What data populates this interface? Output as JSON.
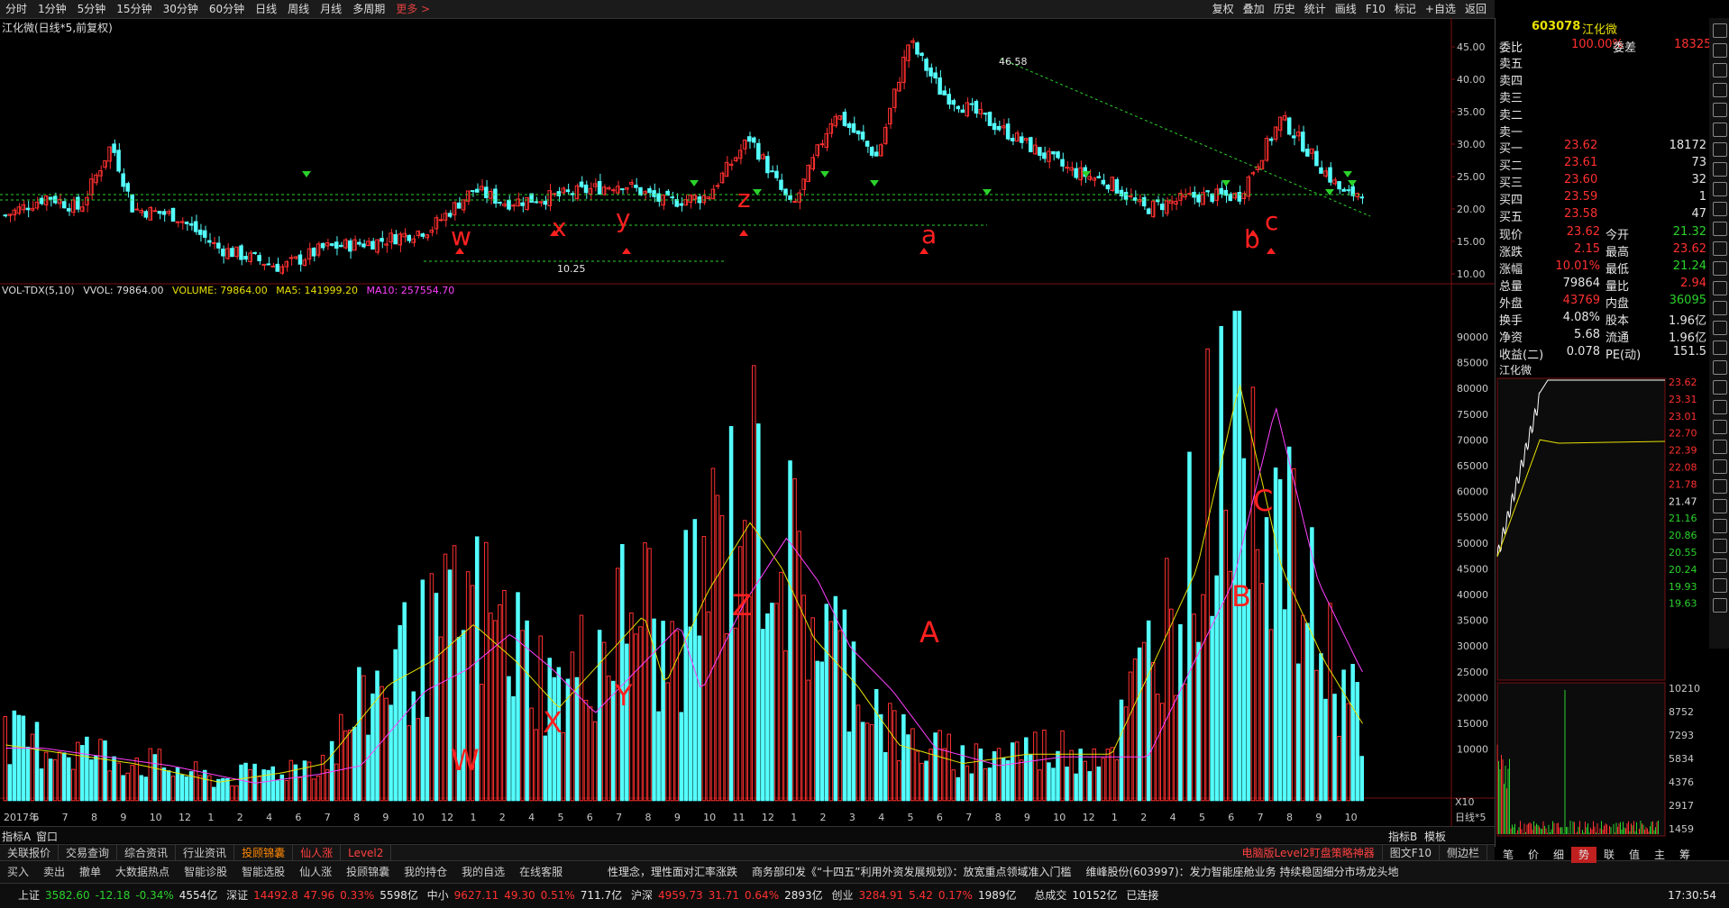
{
  "periods": [
    "分时",
    "1分钟",
    "5分钟",
    "15分钟",
    "30分钟",
    "60分钟",
    "日线",
    "周线",
    "月线",
    "多周期",
    "更多 >"
  ],
  "toolbar_right": [
    "复权",
    "叠加",
    "历史",
    "统计",
    "画线",
    "F10",
    "标记",
    "+自选",
    "返回"
  ],
  "chart": {
    "title": "江化微(日线*5,前复权)",
    "price_high_label": "46.58",
    "price_low_label": "10.25",
    "price_axis": [
      "45.00",
      "40.00",
      "35.00",
      "30.00",
      "25.00",
      "20.00",
      "15.00",
      "10.00"
    ],
    "wave_labels_price": [
      "w",
      "x",
      "y",
      "z",
      "a",
      "b",
      "c"
    ],
    "wave_labels_vol": [
      "W",
      "X",
      "Y",
      "Z",
      "A",
      "B",
      "C"
    ],
    "vol_legend": {
      "name": "VOL-TDX(5,10)",
      "vvol": "VVOL: 79864.00",
      "volume": "VOLUME: 79864.00",
      "ma5": "MA5: 141999.20",
      "ma10": "MA10: 257554.70"
    },
    "vol_axis": [
      "90000",
      "85000",
      "80000",
      "75000",
      "70000",
      "65000",
      "60000",
      "55000",
      "50000",
      "45000",
      "40000",
      "35000",
      "30000",
      "25000",
      "20000",
      "15000",
      "10000"
    ],
    "vol_axis_unit": "X10",
    "date_axis": [
      "2017年",
      "6",
      "7",
      "8",
      "9",
      "10",
      "12",
      "1",
      "2",
      "4",
      "6",
      "7",
      "8",
      "9",
      "10",
      "12",
      "1",
      "2",
      "4",
      "5",
      "6",
      "7",
      "8",
      "9",
      "10",
      "11",
      "12",
      "1",
      "2",
      "3",
      "4",
      "5",
      "6",
      "7",
      "8",
      "9",
      "10",
      "12",
      "1",
      "2",
      "4",
      "5",
      "6",
      "7",
      "8",
      "9",
      "10"
    ],
    "period_label": "日线*5"
  },
  "indicator_tabs": {
    "left": "指标A",
    "window": "窗口",
    "right_b": "指标B",
    "template": "模板"
  },
  "quote": {
    "code": "603078",
    "name": "江化微",
    "weibi_label": "委比",
    "weibi": "100.00%",
    "weicha_label": "委差",
    "weicha": "18325",
    "sell": [
      {
        "label": "卖五"
      },
      {
        "label": "卖四"
      },
      {
        "label": "卖三"
      },
      {
        "label": "卖二"
      },
      {
        "label": "卖一"
      }
    ],
    "buy": [
      {
        "label": "买一",
        "price": "23.62",
        "vol": "18172"
      },
      {
        "label": "买二",
        "price": "23.61",
        "vol": "73"
      },
      {
        "label": "买三",
        "price": "23.60",
        "vol": "32"
      },
      {
        "label": "买四",
        "price": "23.59",
        "vol": "1"
      },
      {
        "label": "买五",
        "price": "23.58",
        "vol": "47"
      }
    ],
    "stats": [
      {
        "l1": "现价",
        "v1": "23.62",
        "l2": "今开",
        "v2": "21.32"
      },
      {
        "l1": "涨跌",
        "v1": "2.15",
        "l2": "最高",
        "v2": "23.62"
      },
      {
        "l1": "涨幅",
        "v1": "10.01%",
        "l2": "最低",
        "v2": "21.24"
      },
      {
        "l1": "总量",
        "v1": "79864",
        "l2": "量比",
        "v2": "2.94"
      },
      {
        "l1": "外盘",
        "v1": "43769",
        "l2": "内盘",
        "v2": "36095"
      },
      {
        "l1": "换手",
        "v1": "4.08%",
        "l2": "股本",
        "v2": "1.96亿"
      },
      {
        "l1": "净资",
        "v1": "5.68",
        "l2": "流通",
        "v2": "1.96亿"
      },
      {
        "l1": "收益(二)",
        "v1": "0.078",
        "l2": "PE(动)",
        "v2": "151.5"
      }
    ],
    "mini_title": "江化微",
    "mini_price_axis": [
      "23.62",
      "23.31",
      "23.01",
      "22.70",
      "22.39",
      "22.08",
      "21.78",
      "21.47",
      "21.16",
      "20.86",
      "20.55",
      "20.24",
      "19.93",
      "19.63"
    ],
    "mini_vol_axis": [
      "10210",
      "8752",
      "7293",
      "5834",
      "4376",
      "2917",
      "1459"
    ],
    "mini_tabs": [
      "笔",
      "价",
      "细",
      "势",
      "联",
      "值",
      "主",
      "筹"
    ]
  },
  "bottom_tabs": [
    "关联报价",
    "交易查询",
    "综合资讯",
    "行业资讯",
    "投顾锦囊",
    "仙人涨",
    "Level2"
  ],
  "bottom_right": [
    "电脑版Level2盯盘策略神器",
    "图文F10",
    "侧边栏"
  ],
  "func_bar": [
    "买入",
    "卖出",
    "撤单",
    "大数据热点",
    "智能诊股",
    "智能选股",
    "仙人涨",
    "投顾锦囊",
    "我的持仓",
    "我的自选",
    "在线客服"
  ],
  "news": [
    "性理念，理性面对汇率涨跌",
    "商务部印发《“十四五”利用外资发展规划》：放宽重点领域准入门槛",
    "维峰股份(603997)：发力智能座舱业务 持续稳固细分市场龙头地"
  ],
  "status": {
    "sh": "上证",
    "sh_v": "3582.60",
    "sh_c": "-12.18",
    "sh_p": "-0.34%",
    "sh_a": "4554亿",
    "sz": "深证",
    "sz_v": "14492.8",
    "sz_c": "47.96",
    "sz_p": "0.33%",
    "sz_a": "5598亿",
    "zx": "中小",
    "zx_v": "9627.11",
    "zx_c": "49.30",
    "zx_p": "0.51%",
    "zx_a": "711.7亿",
    "hs": "沪深",
    "hs_v": "4959.73",
    "hs_c": "31.71",
    "hs_p": "0.64%",
    "hs_a": "2893亿",
    "cy": "创业",
    "cy_v": "3284.91",
    "cy_c": "5.42",
    "cy_p": "0.17%",
    "cy_a": "1989亿",
    "deal_label": "总成交",
    "deal": "10152亿",
    "conn": "已连接",
    "time": "17:30:54"
  },
  "colors": {
    "up": "#ff3030",
    "down": "#54ffff",
    "ma5": "#e8e000",
    "ma10": "#ff40ff",
    "bg": "#000000"
  }
}
